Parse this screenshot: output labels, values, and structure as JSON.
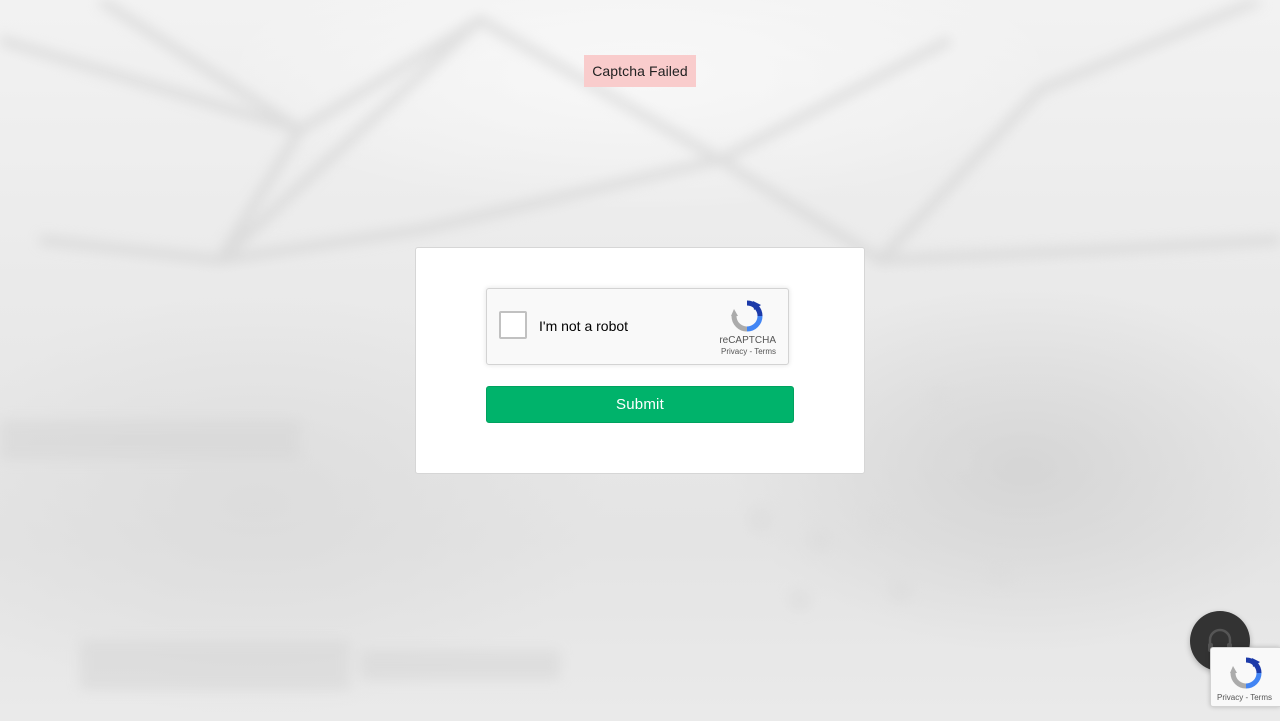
{
  "toast": {
    "message": "Captcha Failed"
  },
  "recaptcha": {
    "label": "I'm not a robot",
    "brand": "reCAPTCHA",
    "privacy": "Privacy",
    "separator": " - ",
    "terms": "Terms"
  },
  "form": {
    "submit_label": "Submit"
  },
  "badge": {
    "privacy": "Privacy",
    "separator": " - ",
    "terms": "Terms"
  },
  "colors": {
    "submit": "#00b36b",
    "toast_bg": "#f9cccc",
    "support_button": "#333333"
  },
  "icons": {
    "recaptcha_logo": "recaptcha-logo-icon",
    "support": "headset-icon"
  }
}
